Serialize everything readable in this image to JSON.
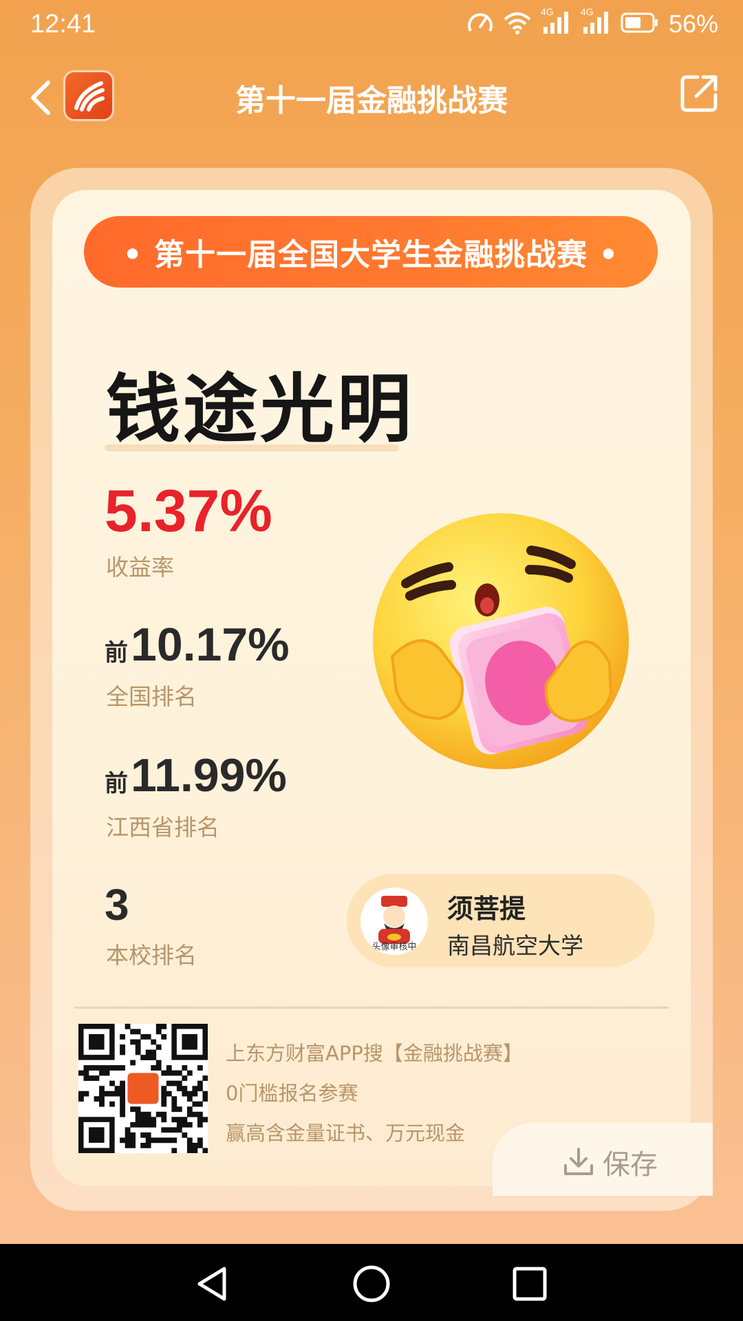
{
  "status_bar": {
    "time": "12:41",
    "battery": "56%",
    "network_label_1": "4G",
    "network_label_2": "4G"
  },
  "header": {
    "title": "第十一届金融挑战赛"
  },
  "card": {
    "banner": "• 第十一届全国大学生金融挑战赛 •",
    "headline": "钱途光明",
    "metrics": {
      "return_rate": {
        "value": "5.37%",
        "label": "收益率"
      },
      "national": {
        "prefix": "前",
        "value": "10.17%",
        "label": "全国排名"
      },
      "province": {
        "prefix": "前",
        "value": "11.99%",
        "label": "江西省排名"
      },
      "school": {
        "value": "3",
        "label": "本校排名"
      }
    },
    "user": {
      "name": "须菩提",
      "school": "南昌航空大学",
      "avatar_badge": "头像审核中"
    },
    "promo": [
      "上东方财富APP搜【金融挑战赛】",
      "0门槛报名参赛",
      "赢高含金量证书、万元现金"
    ],
    "save_label": "保存"
  },
  "colors": {
    "accent": "#ff6a2b",
    "return_rate": "#e8232a",
    "label": "#b8956a"
  }
}
